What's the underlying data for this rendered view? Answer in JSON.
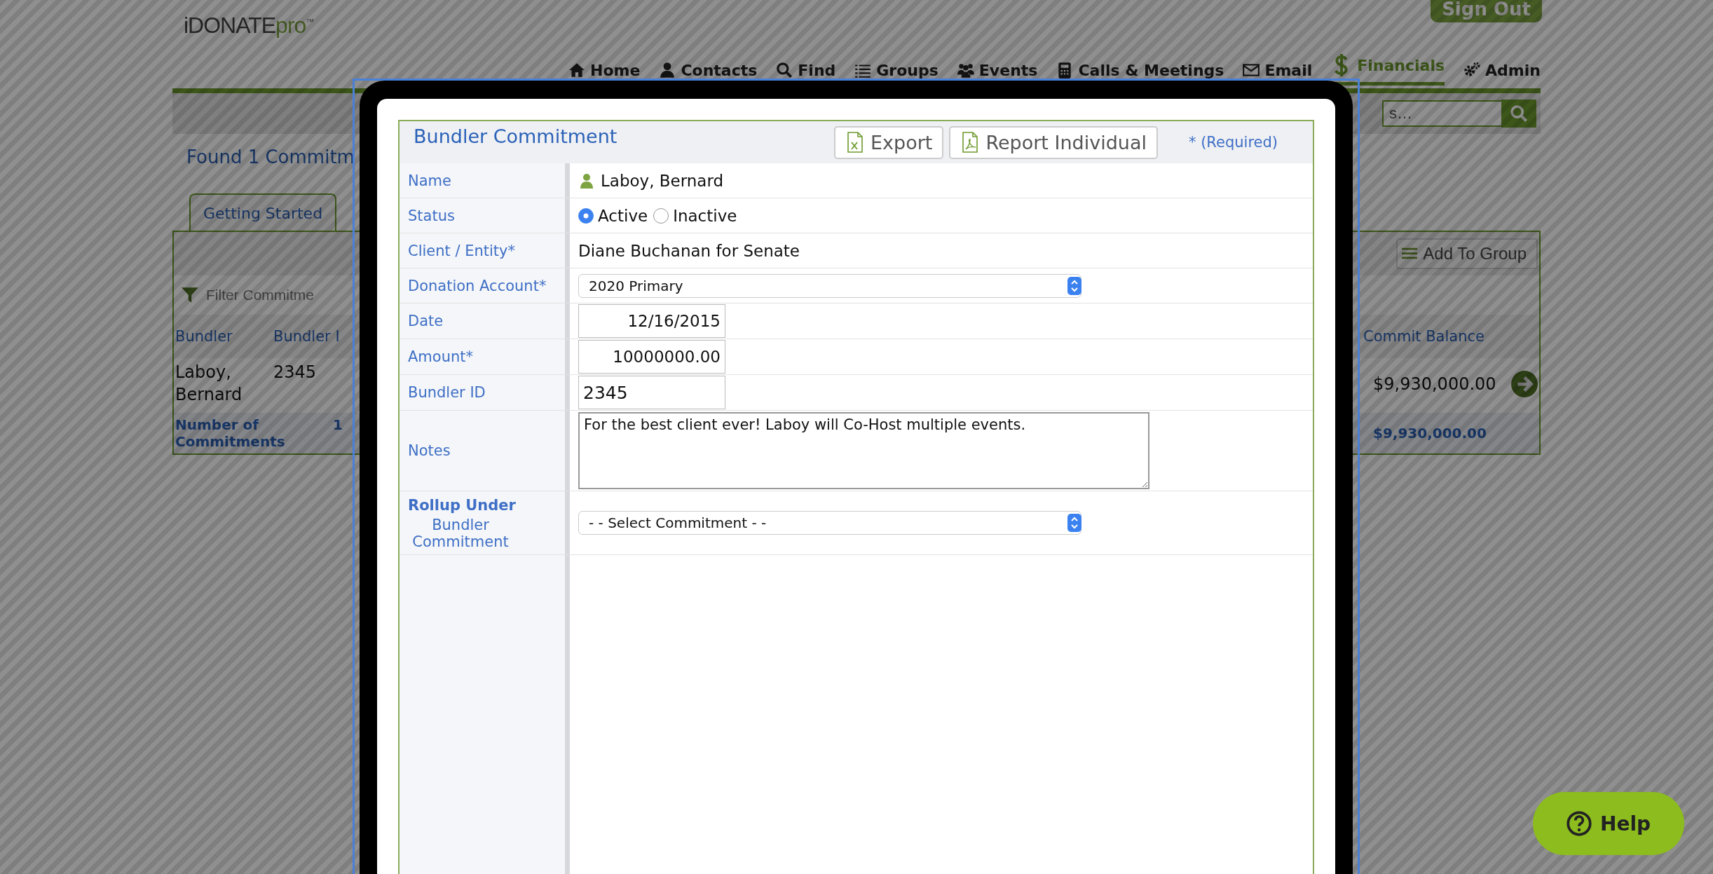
{
  "header": {
    "logo": {
      "main": "iDONATE",
      "suffix": "pro",
      "mark": "™"
    },
    "sign_out": "Sign Out"
  },
  "nav": [
    {
      "label": "Home",
      "selected": false
    },
    {
      "label": "Contacts",
      "selected": false
    },
    {
      "label": "Find",
      "selected": false
    },
    {
      "label": "Groups",
      "selected": false
    },
    {
      "label": "Events",
      "selected": false
    },
    {
      "label": "Calls & Meetings",
      "selected": false
    },
    {
      "label": "Email",
      "selected": false
    },
    {
      "label": "Financials",
      "selected": true
    },
    {
      "label": "Admin",
      "selected": false
    }
  ],
  "search": {
    "placeholder": "s…"
  },
  "page": {
    "heading": "Found 1 Commitm",
    "tabs": [
      {
        "label": "Getting Started",
        "selected": false
      }
    ]
  },
  "toolbar": {
    "add_to_group": "Add To Group"
  },
  "filter": {
    "placeholder": "Filter Commitme"
  },
  "table": {
    "columns": [
      "Bundler",
      "Bundler I",
      "Commit Balance"
    ],
    "rows": [
      {
        "bundler": "Laboy, Bernard",
        "bundler_id": "2345",
        "commit_balance": "$9,930,000.00"
      }
    ],
    "footer": {
      "label": "Number of Commitments",
      "count": "1",
      "commit_balance": "$9,930,000.00"
    }
  },
  "modal": {
    "title": "Bundler Commitment",
    "buttons": [
      {
        "label": "Export",
        "kind": "excel"
      },
      {
        "label": "Report Individual",
        "kind": "pdf"
      }
    ],
    "required_note": "* (Required)",
    "fields": [
      {
        "kind": "person",
        "label": "Name",
        "value": "Laboy, Bernard"
      },
      {
        "kind": "radio",
        "label": "Status",
        "options": [
          {
            "label": "Active",
            "selected": true
          },
          {
            "label": "Inactive",
            "selected": false
          }
        ]
      },
      {
        "kind": "text",
        "label": "Client / Entity*",
        "value": "Diane Buchanan for Senate"
      },
      {
        "kind": "select",
        "label": "Donation Account*",
        "value": "2020 Primary"
      },
      {
        "kind": "numeric",
        "label": "Date",
        "value": "12/16/2015"
      },
      {
        "kind": "numeric",
        "label": "Amount*",
        "value": "10000000.00"
      },
      {
        "kind": "input",
        "label": "Bundler ID",
        "value": "2345"
      },
      {
        "kind": "textarea",
        "label": "Notes",
        "value": "For the best client ever! Laboy will Co-Host multiple events."
      },
      {
        "kind": "select",
        "label": "Rollup Under",
        "sublabel": "Bundler Commitment",
        "value": "- - Select Commitment - -"
      }
    ]
  },
  "help": {
    "label": "Help"
  }
}
